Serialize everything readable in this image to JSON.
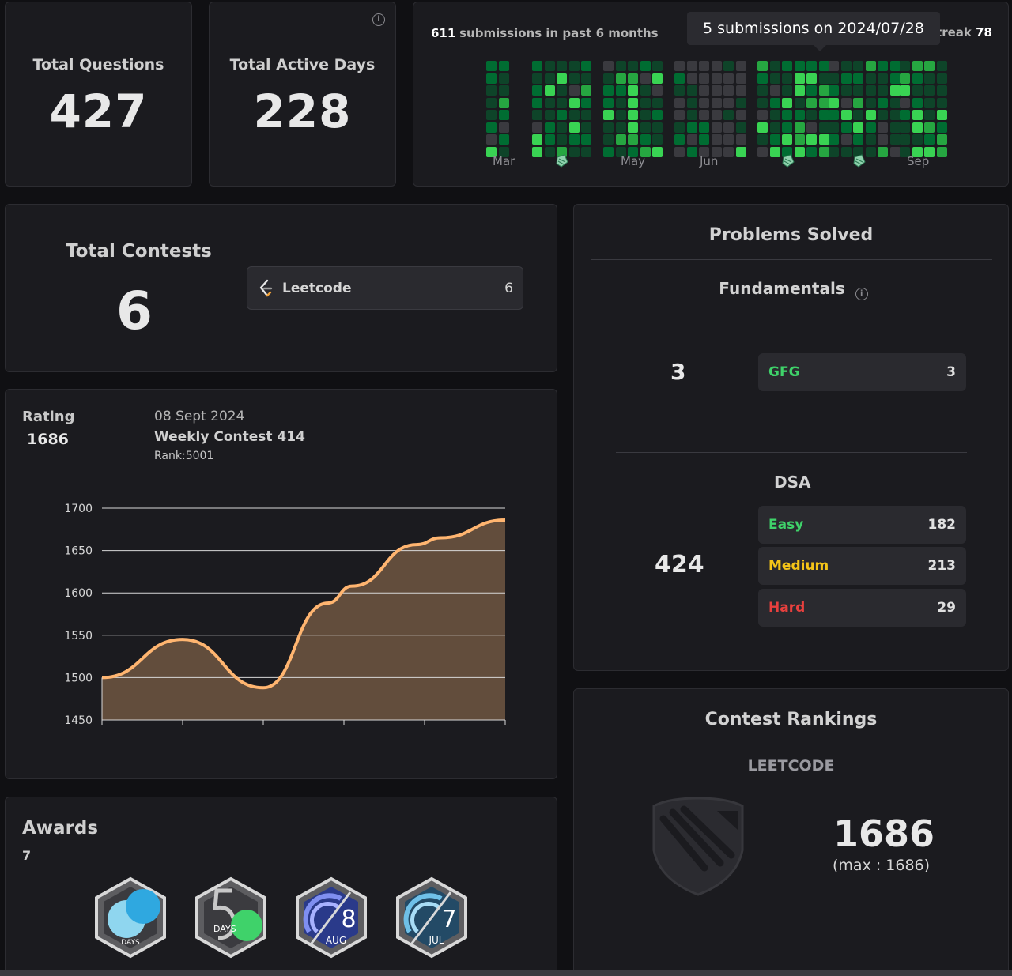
{
  "stats": {
    "total_questions": {
      "title": "Total Questions",
      "value": "427"
    },
    "total_active_days": {
      "title": "Total Active Days",
      "value": "228"
    }
  },
  "heatmap": {
    "submissions_count": "611",
    "submissions_text": "submissions in past 6 months",
    "streak_fragment": "treak",
    "streak_value": "78",
    "tooltip": "5 submissions on 2024/07/28",
    "months": [
      "Mar",
      "May",
      "Jun",
      "Sep"
    ],
    "colors": {
      "empty": "#3a3a3f",
      "level1": "#0e4429",
      "level2": "#006d32",
      "level3": "#26a641",
      "level4": "#39d353"
    }
  },
  "contests": {
    "title": "Total Contests",
    "value": "6",
    "platforms": [
      {
        "name": "Leetcode",
        "count": "6"
      }
    ]
  },
  "rating": {
    "label": "Rating",
    "value": "1686",
    "date": "08 Sept 2024",
    "contest": "Weekly Contest 414",
    "rank": "Rank:5001"
  },
  "chart_data": {
    "type": "area",
    "title": "",
    "xlabel": "",
    "ylabel": "",
    "ylim": [
      1450,
      1700
    ],
    "yticks": [
      "1700",
      "1650",
      "1600",
      "1550",
      "1500",
      "1450"
    ],
    "x": [
      0,
      0.5,
      1,
      1.5,
      2,
      2.5,
      3,
      3.5,
      4,
      4.5,
      5
    ],
    "values": [
      1500,
      1545,
      1488,
      1588,
      1608,
      1657,
      1665,
      1686
    ],
    "x_positions": [
      0,
      1,
      2,
      2.8,
      3.1,
      3.9,
      4.2,
      5
    ],
    "line_color": "#ffb570",
    "fill_color": "#6f5642",
    "grid": true
  },
  "awards": {
    "title": "Awards",
    "count": "7",
    "items": [
      {
        "name": "days-badge",
        "label": "DAYS"
      },
      {
        "name": "50-days-badge",
        "label": "DAYS"
      },
      {
        "name": "aug-badge",
        "number": "8",
        "label": "AUG"
      },
      {
        "name": "jul-badge",
        "number": "7",
        "label": "JUL"
      }
    ]
  },
  "problems": {
    "title": "Problems Solved",
    "fundamentals": {
      "title": "Fundamentals",
      "total": "3",
      "items": [
        {
          "label": "GFG",
          "count": "3",
          "color": "#3fd26a"
        }
      ]
    },
    "dsa": {
      "title": "DSA",
      "total": "424",
      "items": [
        {
          "label": "Easy",
          "count": "182",
          "color": "#3fd26a"
        },
        {
          "label": "Medium",
          "count": "213",
          "color": "#f5c518"
        },
        {
          "label": "Hard",
          "count": "29",
          "color": "#e8403e"
        }
      ]
    }
  },
  "rankings": {
    "title": "Contest Rankings",
    "platform": "LEETCODE",
    "rating": "1686",
    "max": "(max : 1686)"
  }
}
